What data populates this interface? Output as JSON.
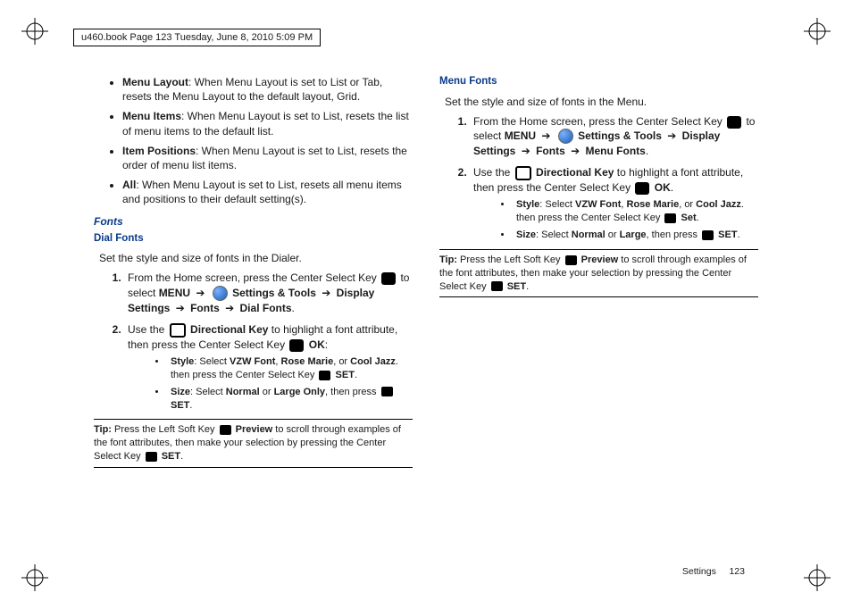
{
  "bookline": "u460.book  Page 123  Tuesday, June 8, 2010  5:09 PM",
  "left": {
    "b1": {
      "t": "Menu Layout",
      "d": ": When Menu Layout is set to List or Tab, resets the Menu Layout to the default layout, Grid."
    },
    "b2": {
      "t": "Menu Items",
      "d": ": When Menu Layout is set to List, resets the list of menu items to the default list."
    },
    "b3": {
      "t": "Item Positions",
      "d": ": When Menu Layout is set to List, resets the order of menu list items."
    },
    "b4": {
      "t": "All",
      "d": ": When Menu Layout is set to List, resets all menu items and positions to their default setting(s)."
    },
    "h_fonts": "Fonts",
    "h_dial": "Dial Fonts",
    "intro": "Set the style and size of fonts in the Dialer.",
    "s1a": "From the Home screen, press the Center Select Key ",
    "s1b": " to select ",
    "s1c": "MENU",
    "s1d": "Settings & Tools",
    "s1e": "Display Settings",
    "s1f": "Fonts",
    "s1g": "Dial Fonts",
    "s2a": "Use the ",
    "s2b": "Directional Key",
    "s2c": " to highlight a font attribute, then press the Center Select Key ",
    "s2d": "OK",
    "s2e": ":",
    "sb1": {
      "t": "Style",
      "d": ": Select ",
      "o1": "VZW Font",
      "o2": "Rose Marie",
      "o3": "Cool Jazz",
      "r": ". then press the Center Select Key ",
      "set": "SET"
    },
    "sb2": {
      "t": "Size",
      "d": ": Select ",
      "o1": "Normal",
      "o2": "Large Only",
      "r": ", then press ",
      "set": "SET"
    },
    "tip": {
      "t": "Tip:",
      "a": " Press the Left Soft Key ",
      "b": "Preview",
      "c": " to scroll through examples of the font attributes, then make your selection by pressing the Center Select Key ",
      "d": "SET"
    }
  },
  "right": {
    "h_menu": "Menu Fonts",
    "intro": "Set the style and size of fonts in the Menu.",
    "s1a": "From the Home screen, press the Center Select Key ",
    "s1b": " to select ",
    "s1c": "MENU",
    "s1d": "Settings & Tools",
    "s1e": "Display Settings",
    "s1f": "Fonts",
    "s1g": "Menu Fonts",
    "s2a": "Use the ",
    "s2b": "Directional Key",
    "s2c": " to highlight a font attribute, then press the Center Select Key ",
    "s2d": "OK",
    "sb1": {
      "t": "Style",
      "d": ": Select ",
      "o1": "VZW Font",
      "o2": "Rose Marie",
      "o3": "Cool Jazz",
      "r": ". then press the Center Select Key ",
      "set": "Set"
    },
    "sb2": {
      "t": "Size",
      "d": ": Select ",
      "o1": "Normal",
      "o2": "Large",
      "r": ", then press ",
      "set": "SET"
    },
    "tip": {
      "t": "Tip:",
      "a": " Press the Left Soft Key ",
      "b": "Preview",
      "c": " to scroll through examples of the font attributes, then make your selection by pressing the Center Select Key ",
      "d": "SET"
    }
  },
  "footer": {
    "a": "Settings",
    "b": "123"
  }
}
